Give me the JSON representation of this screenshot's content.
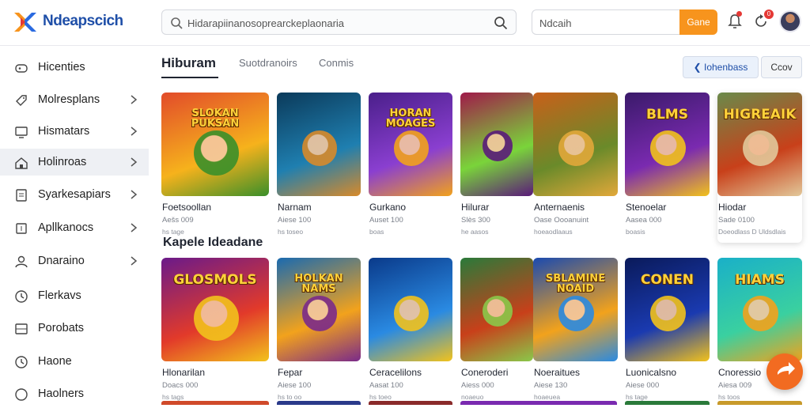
{
  "header": {
    "brand": "Ndeapscich",
    "search_value": "Hidarapiinanosoprearckeplaonaria",
    "login_value": "Ndcaih",
    "go_label": "Gane",
    "notification_count": "0"
  },
  "sidebar": {
    "items": [
      {
        "label": "Hicenties",
        "icon": "gamepad-icon",
        "chevron": false
      },
      {
        "label": "Molresplans",
        "icon": "tag-icon",
        "chevron": true
      },
      {
        "label": "Hismatars",
        "icon": "monitor-icon",
        "chevron": true
      },
      {
        "label": "Holinroas",
        "icon": "home-icon",
        "chevron": true
      },
      {
        "label": "Syarkesapiars",
        "icon": "document-icon",
        "chevron": true
      },
      {
        "label": "Apllkanocs",
        "icon": "square-icon",
        "chevron": true
      },
      {
        "label": "Dnaraino",
        "icon": "user-icon",
        "chevron": true
      },
      {
        "label": "Flerkavs",
        "icon": "clock-icon",
        "chevron": false
      },
      {
        "label": "Porobats",
        "icon": "grid-icon",
        "chevron": false
      },
      {
        "label": "Haone",
        "icon": "clock-icon",
        "chevron": false
      },
      {
        "label": "Haolners",
        "icon": "circle-icon",
        "chevron": false
      }
    ]
  },
  "tabs": [
    {
      "label": "Hiburam"
    },
    {
      "label": "Suotdranoirs"
    },
    {
      "label": "Conmis"
    }
  ],
  "filters": {
    "primary": "Iohenbass",
    "secondary": "Ccov"
  },
  "section_title": "Kapele Ideadane",
  "row1": [
    {
      "art": "SLOKAN PUKSAN",
      "name": "Foetsoollan",
      "meta1": "Aešs 009",
      "meta2": "hs tage",
      "colors": [
        "#e24b2a",
        "#f6b21c",
        "#3a8f2a"
      ]
    },
    {
      "art": "",
      "name": "Narnam",
      "meta1": "Aiese 100",
      "meta2": "hs toseo",
      "colors": [
        "#0b3a5a",
        "#1f7fb0",
        "#d88a2a"
      ]
    },
    {
      "art": "HORAN MOAGES",
      "name": "Gurkano",
      "meta1": "Auset 100",
      "meta2": "boas",
      "colors": [
        "#4a1f8a",
        "#8a3fd0",
        "#f2a21c"
      ]
    },
    {
      "art": "",
      "name": "Hilurar",
      "meta1": "Slès 300",
      "meta2": "he aasos",
      "colors": [
        "#a01a4a",
        "#7ad43a",
        "#5a1a7a"
      ]
    },
    {
      "art": "",
      "name": "Anternaenis",
      "meta1": "Oase Oooanuint",
      "meta2": "hoeaodlaaus",
      "colors": [
        "#c8601a",
        "#6a8a2a",
        "#e2a83a"
      ]
    },
    {
      "art": "BLMS",
      "name": "Stenoelar",
      "meta1": "Aasea 000",
      "meta2": "boasis",
      "colors": [
        "#3a1a6a",
        "#7a2ab0",
        "#f2c21c"
      ]
    },
    {
      "art": "HIGREAIK",
      "name": "Hiodar",
      "meta1": "Sade 0100",
      "meta2": "Doeodlass D Uldsdlais",
      "colors": [
        "#6a8a4a",
        "#c8401a",
        "#e2c89a"
      ]
    }
  ],
  "row2": [
    {
      "art": "GLOSMOLS",
      "name": "Hlonarilan",
      "meta1": "Doacs 000",
      "meta2": "hs tags",
      "colors": [
        "#6a1a8a",
        "#e23a2a",
        "#f2c21c"
      ]
    },
    {
      "art": "HOLKAN NAMS",
      "name": "Fepar",
      "meta1": "Aiese 100",
      "meta2": "hs to oo",
      "colors": [
        "#1a6ab0",
        "#f2a21c",
        "#7a2a8a"
      ]
    },
    {
      "art": "",
      "name": "Ceracelilons",
      "meta1": "Aasat 100",
      "meta2": "hs toeo",
      "colors": [
        "#0a3a8a",
        "#2a8ae2",
        "#f2c21c"
      ]
    },
    {
      "art": "",
      "name": "Coneroderi",
      "meta1": "Aiess 000",
      "meta2": "noaeuo",
      "colors": [
        "#2a7a3a",
        "#c8401a",
        "#8ac84a"
      ]
    },
    {
      "art": "SBLAMINE NOAID",
      "name": "Noeraitues",
      "meta1": "Aiese 130",
      "meta2": "hoaeuea",
      "colors": [
        "#1a4ab0",
        "#f2a21c",
        "#2a8ae2"
      ]
    },
    {
      "art": "CONEN",
      "name": "Luonicalsno",
      "meta1": "Aiese 000",
      "meta2": "hs tage",
      "colors": [
        "#0a1a5a",
        "#1a3ab0",
        "#f2c21c"
      ]
    },
    {
      "art": "HIAMS",
      "name": "Cnoressio",
      "meta1": "Aiesa 009",
      "meta2": "hs toos",
      "colors": [
        "#1ab0c8",
        "#3ad0a0",
        "#f2a21c"
      ]
    }
  ]
}
